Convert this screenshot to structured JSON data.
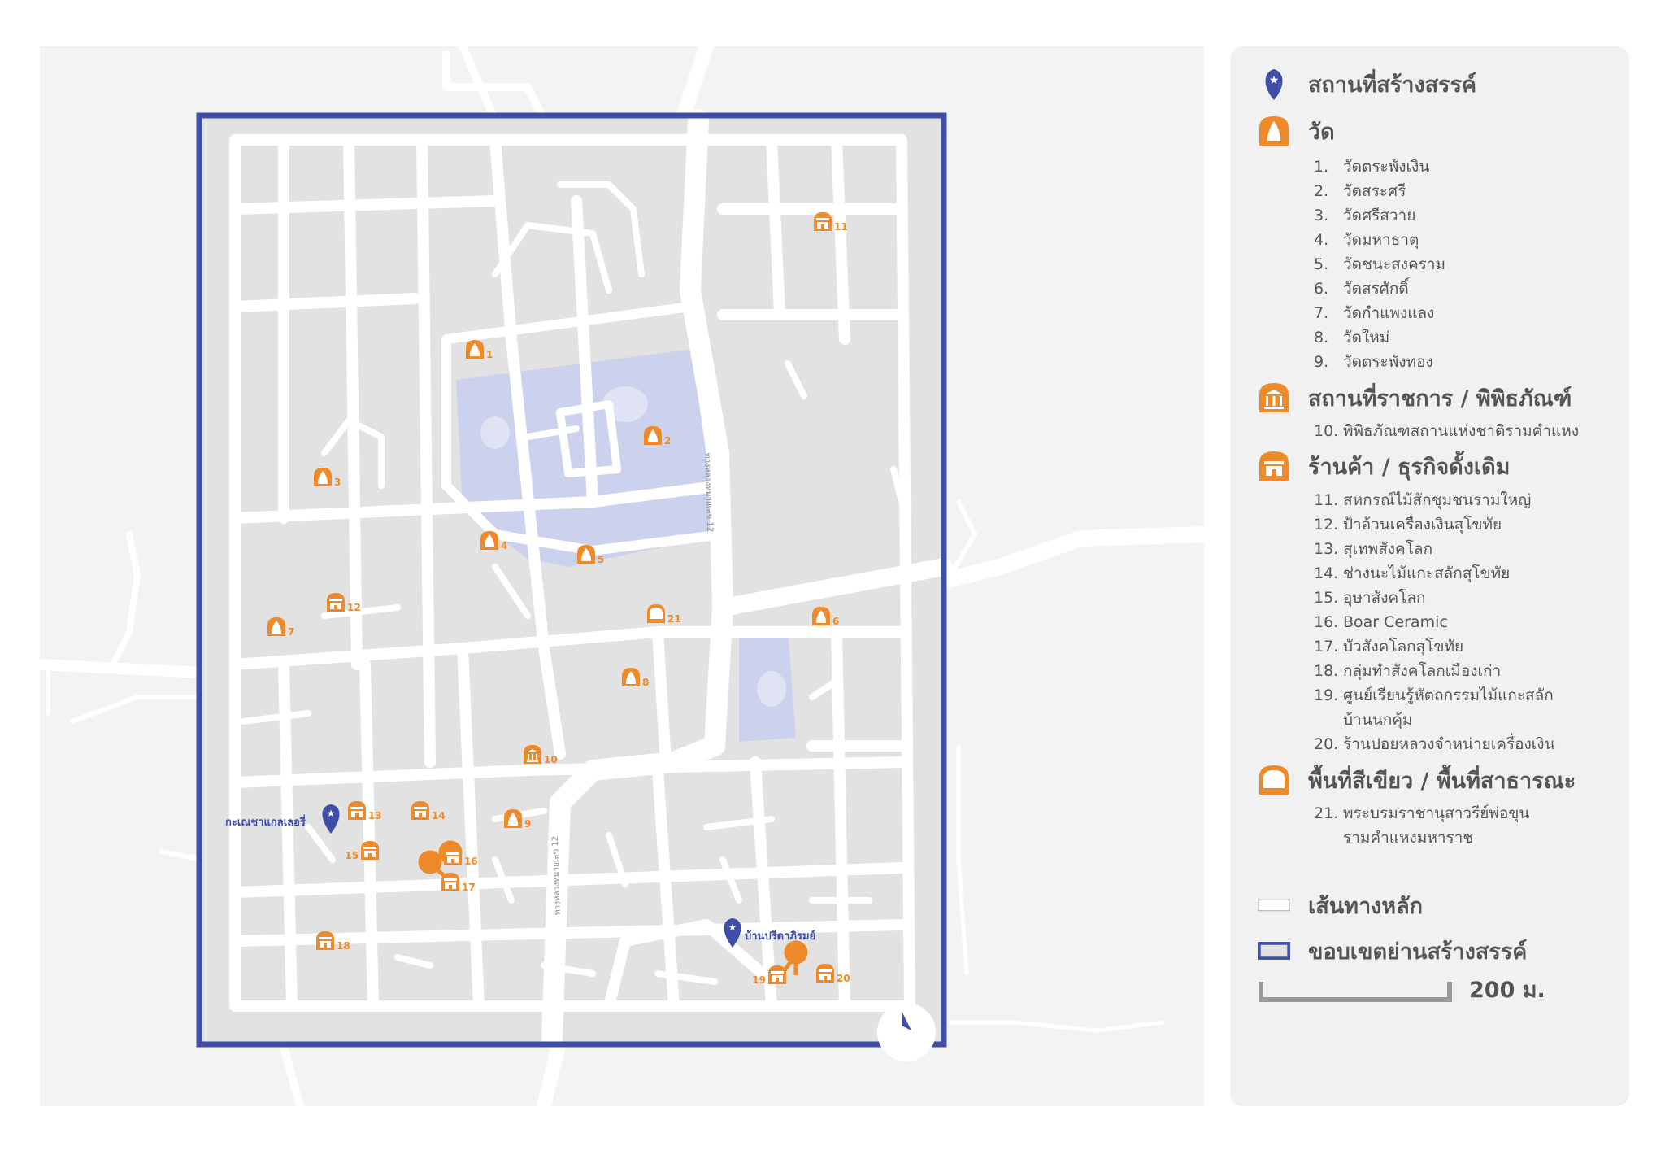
{
  "legend": {
    "creative_place": {
      "label": "สถานที่สร้างสรรค์",
      "icon": "star-pin-icon"
    },
    "temple": {
      "label": "วัด",
      "icon": "temple-icon",
      "items": [
        {
          "num": "1.",
          "name": "วัดตระพังเงิน"
        },
        {
          "num": "2.",
          "name": "วัดสระศรี"
        },
        {
          "num": "3.",
          "name": "วัดศรีสวาย"
        },
        {
          "num": "4.",
          "name": "วัดมหาธาตุ"
        },
        {
          "num": "5.",
          "name": "วัดชนะสงคราม"
        },
        {
          "num": "6.",
          "name": "วัดสรศักดิ์"
        },
        {
          "num": "7.",
          "name": "วัดกำแพงแลง"
        },
        {
          "num": "8.",
          "name": "วัดใหม่"
        },
        {
          "num": "9.",
          "name": "วัดตระพังทอง"
        }
      ]
    },
    "government": {
      "label": "สถานที่ราชการ / พิพิธภัณฑ์",
      "icon": "museum-icon",
      "items": [
        {
          "num": "10.",
          "name": "พิพิธภัณฑสถานแห่งชาติรามคำแหง"
        }
      ]
    },
    "shop": {
      "label": "ร้านค้า / ธุรกิจดั้งเดิม",
      "icon": "shop-icon",
      "items": [
        {
          "num": "11.",
          "name": "สหกรณ์ไม้สักชุมชนรามใหญ่"
        },
        {
          "num": "12.",
          "name": "ป้าอ้วนเครื่องเงินสุโขทัย"
        },
        {
          "num": "13.",
          "name": "สุเทพสังคโลก"
        },
        {
          "num": "14.",
          "name": "ช่างนะไม้แกะสลักสุโขทัย"
        },
        {
          "num": "15.",
          "name": "อุษาสังคโลก"
        },
        {
          "num": "16.",
          "name": "Boar Ceramic"
        },
        {
          "num": "17.",
          "name": "บัวสังคโลกสุโขทัย"
        },
        {
          "num": "18.",
          "name": "กลุ่มทำสังคโลกเมืองเก่า"
        },
        {
          "num": "19.",
          "name": "ศูนย์เรียนรู้หัตถกรรมไม้แกะสลัก\nบ้านนกคุ้ม"
        },
        {
          "num": "20.",
          "name": "ร้านปอยหลวงจำหน่ายเครื่องเงิน"
        }
      ]
    },
    "green": {
      "label": "พื้นที่สีเขียว / พื้นที่สาธารณะ",
      "icon": "public-space-icon",
      "items": [
        {
          "num": "21.",
          "name": "พระบรมราชานุสาวรีย์พ่อขุน\nรามคำแหงมหาราช"
        }
      ]
    },
    "main_road": {
      "label": "เส้นทางหลัก",
      "icon": "main-road-line-icon"
    },
    "boundary": {
      "label": "ขอบเขตย่านสร้างสรรค์",
      "icon": "boundary-box-icon"
    },
    "scale": {
      "label": "200 ม."
    }
  },
  "map": {
    "place_labels": {
      "ganesha": "กะเณชาแกลเลอรี่",
      "preeda": "บ้านปรีดาภิรมย์"
    },
    "road_label": "ทางหลวงหมายเลข 12",
    "markers": [
      {
        "num": "1",
        "type": "temple"
      },
      {
        "num": "2",
        "type": "temple"
      },
      {
        "num": "3",
        "type": "temple"
      },
      {
        "num": "4",
        "type": "temple"
      },
      {
        "num": "5",
        "type": "temple"
      },
      {
        "num": "6",
        "type": "temple"
      },
      {
        "num": "7",
        "type": "temple"
      },
      {
        "num": "8",
        "type": "temple"
      },
      {
        "num": "9",
        "type": "temple"
      },
      {
        "num": "10",
        "type": "museum"
      },
      {
        "num": "11",
        "type": "shop"
      },
      {
        "num": "12",
        "type": "shop"
      },
      {
        "num": "13",
        "type": "shop"
      },
      {
        "num": "14",
        "type": "shop"
      },
      {
        "num": "15",
        "type": "shop"
      },
      {
        "num": "16",
        "type": "shop"
      },
      {
        "num": "17",
        "type": "shop"
      },
      {
        "num": "18",
        "type": "shop"
      },
      {
        "num": "19",
        "type": "shop"
      },
      {
        "num": "20",
        "type": "shop"
      },
      {
        "num": "21",
        "type": "green"
      }
    ]
  },
  "colors": {
    "accent": "#ee8a2a",
    "boundary": "#3f4ea6",
    "water": "#ccd2ee",
    "road": "#ffffff",
    "district": "#e2e2e2"
  }
}
